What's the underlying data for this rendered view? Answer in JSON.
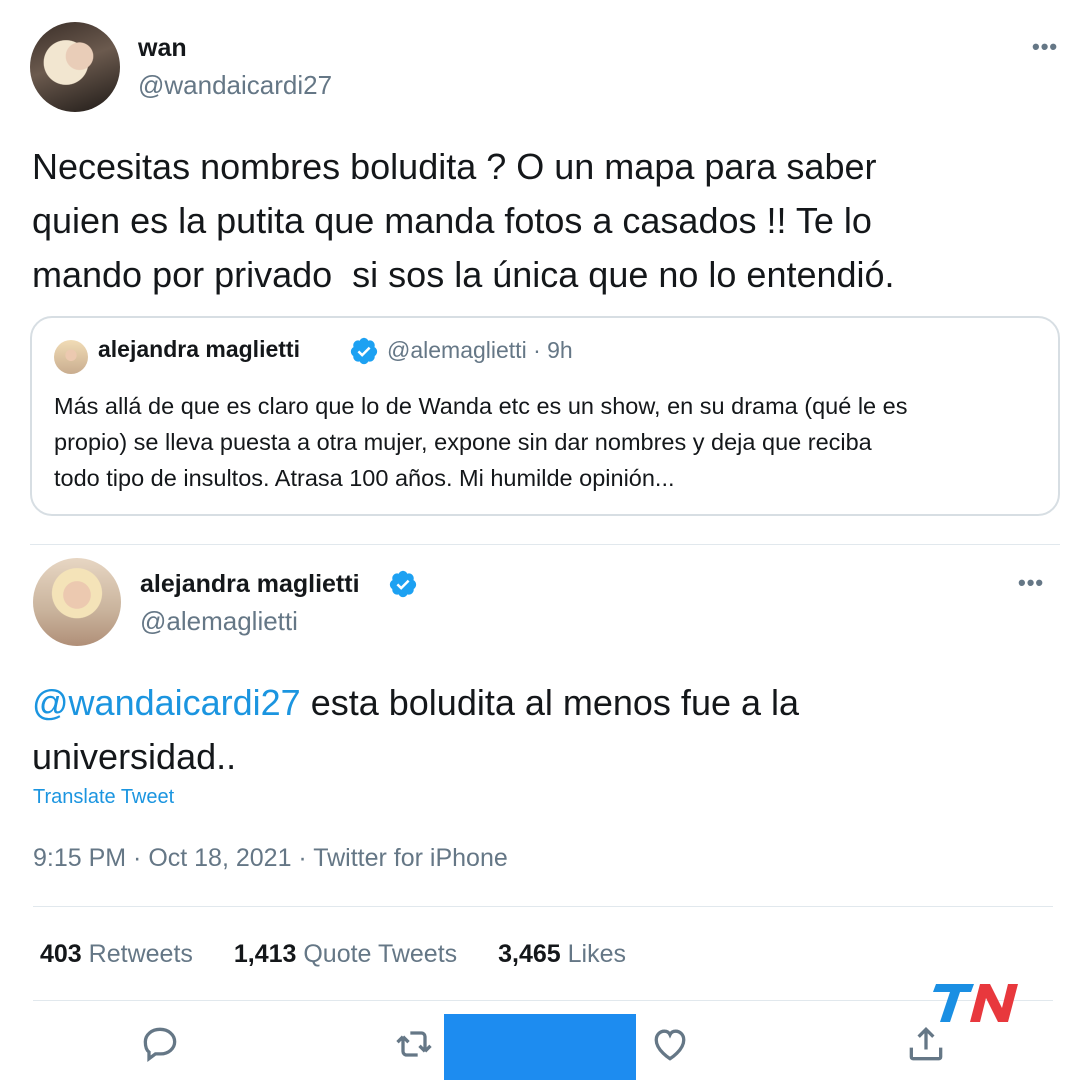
{
  "tweet1": {
    "display_name": "wan",
    "handle": "@wandaicardi27",
    "text": "Necesitas nombres boludita ? O un mapa para saber\nquien es la putita que manda fotos a casados !! Te lo\nmando por privado  si sos la única que no lo entendió."
  },
  "quote": {
    "display_name": "alejandra maglietti",
    "handle_time": "@alemaglietti · 9h",
    "text": "Más allá de que es claro que lo de Wanda etc es un show, en su drama (qué le es\npropio) se lleva puesta a otra mujer, expone sin dar nombres y deja que reciba\ntodo tipo de insultos. Atrasa 100 años. Mi humilde opinión..."
  },
  "tweet2": {
    "display_name": "alejandra maglietti",
    "handle": "@alemaglietti",
    "mention": "@wandaicardi27",
    "text_line1": " esta boludita al menos fue a la",
    "text_line2": "universidad..",
    "translate": "Translate Tweet",
    "meta": "9:15 PM · Oct 18, 2021 · Twitter for iPhone",
    "stats": {
      "retweets_count": "403",
      "retweets_label": "Retweets",
      "quotes_count": "1,413",
      "quotes_label": "Quote Tweets",
      "likes_count": "3,465",
      "likes_label": "Likes"
    }
  },
  "more_glyph": "•••",
  "watermark": "TN",
  "colors": {
    "accent": "#1b95e0",
    "muted": "#657786",
    "text": "#14171a",
    "verified": "#1da1f2",
    "watermark_blue": "#1a8fe3",
    "watermark_red": "#e8383d"
  },
  "icons": {
    "reply": "comment-bubble-icon",
    "retweet": "retweet-icon",
    "like": "heart-icon",
    "share": "share-upload-icon",
    "verified": "verified-badge-icon",
    "more": "more-dots-icon"
  }
}
